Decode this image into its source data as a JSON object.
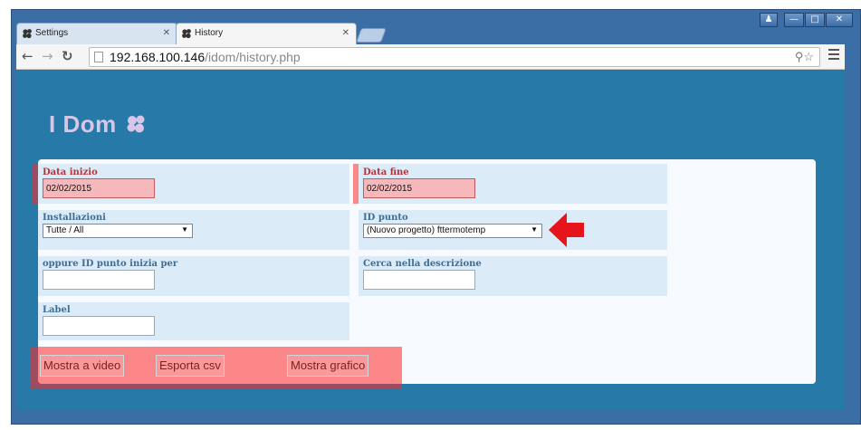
{
  "browser": {
    "tabs": [
      {
        "title": "Settings",
        "active": false
      },
      {
        "title": "History",
        "active": true
      }
    ],
    "url_host": "192.168.100.146",
    "url_path": "/idom/history.php"
  },
  "page": {
    "logo_text": "I Dom",
    "form": {
      "data_inizio": {
        "label": "Data inizio",
        "value": "02/02/2015"
      },
      "data_fine": {
        "label": "Data fine",
        "value": "02/02/2015"
      },
      "installazioni": {
        "label": "Installazioni",
        "value": "Tutte / All"
      },
      "id_punto": {
        "label": "ID punto",
        "value": "(Nuovo progetto) fttermotemp"
      },
      "oppure_id": {
        "label": "oppure ID punto inizia per",
        "value": ""
      },
      "cerca": {
        "label": "Cerca nella descrizione",
        "value": ""
      },
      "label": {
        "label": "Label",
        "value": ""
      }
    },
    "buttons": {
      "mostra_video": "Mostra a video",
      "esporta_csv": "Esporta csv",
      "mostra_grafico": "Mostra grafico"
    }
  },
  "colors": {
    "page_bg": "#2779a8",
    "highlight": "#ff2828",
    "label": "#3e6d95"
  }
}
